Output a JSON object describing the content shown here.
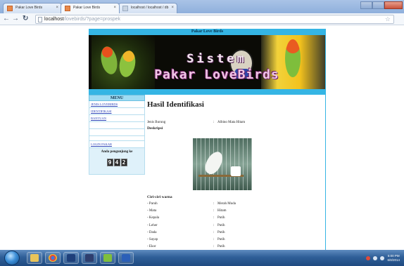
{
  "browser": {
    "tabs": [
      {
        "title": "Pakar Love Birds"
      },
      {
        "title": "Pakar Love Birds"
      },
      {
        "title": "localhost / localhost / db"
      }
    ],
    "url_host": "localhost",
    "url_path": "/lovebirds/?page=prospek"
  },
  "site": {
    "header_title": "Pakar Love Birds",
    "banner_line1": "Sistem",
    "banner_line2": "Pakar LoveBirds"
  },
  "menu": {
    "heading": "MENU",
    "items": [
      {
        "label": "JENIS LOVEBIRDS"
      },
      {
        "label": "IDENTIFIKASI"
      },
      {
        "label": "BANTUAN"
      }
    ],
    "login_label": "LOGIN PAKAR",
    "visitor_label": "Anda pengunjung ke",
    "visitor_digits": [
      "9",
      "4",
      "2"
    ]
  },
  "result": {
    "title": "Hasil Identifikasi",
    "type_label": "Jenis Burung",
    "type_value": "Albino Mata Hitam",
    "description_label": "Deskripsi",
    "features_label": "Ciri-ciri warna",
    "features": [
      {
        "part": "- Paruh",
        "color": "Merah Muda"
      },
      {
        "part": "- Mata",
        "color": "Hitam"
      },
      {
        "part": "- Kepala",
        "color": "Putih"
      },
      {
        "part": "- Leher",
        "color": "Putih"
      },
      {
        "part": "- Dada",
        "color": "Putih"
      },
      {
        "part": "- Sayap",
        "color": "Putih"
      },
      {
        "part": "- Ekor",
        "color": "Putih"
      }
    ]
  },
  "taskbar": {
    "time": "5:00 PM",
    "date": "6/8/2014"
  },
  "colors": {
    "accent": "#35b5e4",
    "menu_head": "#9fdcf3",
    "link": "#2b44b8"
  }
}
